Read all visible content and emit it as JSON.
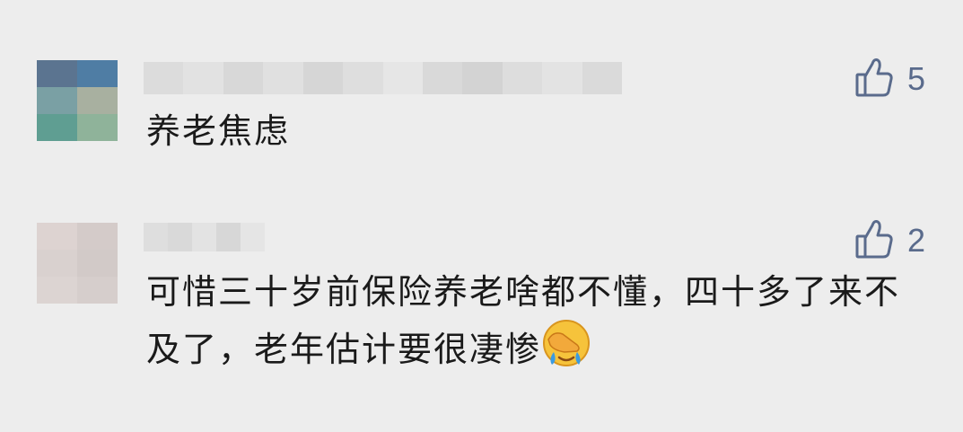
{
  "comments": [
    {
      "text": "养老焦虑",
      "likes": "5"
    },
    {
      "text": "可惜三十岁前保险养老啥都不懂，四十多了来不及了，老年估计要很凄惨",
      "likes": "2",
      "emoji": "face-palm-crying-emoji"
    }
  ],
  "colors": {
    "background": "#ededed",
    "like_icon": "#5a6b8c",
    "text": "#1a1a1a"
  }
}
